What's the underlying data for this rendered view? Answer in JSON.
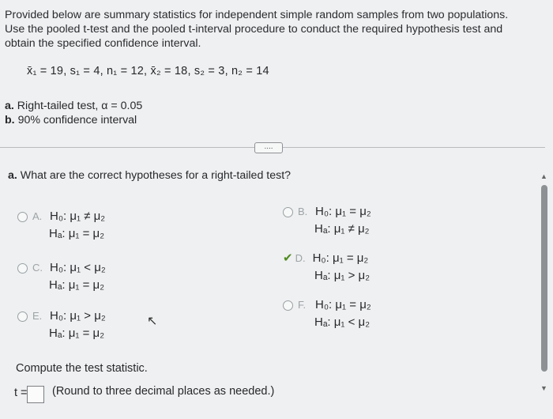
{
  "intro": {
    "line1": "Provided below are summary statistics for independent simple random samples from two populations.",
    "line2": "Use the pooled t-test and the pooled t-interval procedure to conduct the required hypothesis test and",
    "line3": "obtain the specified confidence interval."
  },
  "given": "x̄₁ = 19, s₁ = 4, n₁ = 12, x̄₂ = 18, s₂ = 3, n₂ = 14",
  "parts": {
    "a_label": "a.",
    "a_text": "Right-tailed test, α = 0.05",
    "b_label": "b.",
    "b_text": "90% confidence interval"
  },
  "expand_button": "....",
  "question": {
    "label": "a.",
    "text": "What are the correct hypotheses for a right-tailed test?"
  },
  "options": [
    {
      "letter": "A.",
      "h0": "H₀: μ₁ ≠ μ₂",
      "ha": "Hₐ: μ₁ = μ₂",
      "selected": false
    },
    {
      "letter": "B.",
      "h0": "H₀: μ₁ = μ₂",
      "ha": "Hₐ: μ₁ ≠ μ₂",
      "selected": false
    },
    {
      "letter": "C.",
      "h0": "H₀: μ₁ < μ₂",
      "ha": "Hₐ: μ₁ = μ₂",
      "selected": false
    },
    {
      "letter": "D.",
      "h0": "H₀: μ₁ = μ₂",
      "ha": "Hₐ: μ₁ > μ₂",
      "selected": true
    },
    {
      "letter": "E.",
      "h0": "H₀: μ₁ > μ₂",
      "ha": "Hₐ: μ₁ = μ₂",
      "selected": false
    },
    {
      "letter": "F.",
      "h0": "H₀: μ₁ = μ₂",
      "ha": "Hₐ: μ₁ < μ₂",
      "selected": false
    }
  ],
  "compute": "Compute the test statistic.",
  "t_label": "t =",
  "t_value": "",
  "round_note": "(Round to three decimal places as needed.)",
  "colors": {
    "check": "#4f8a1f",
    "background": "#eef0f1"
  }
}
